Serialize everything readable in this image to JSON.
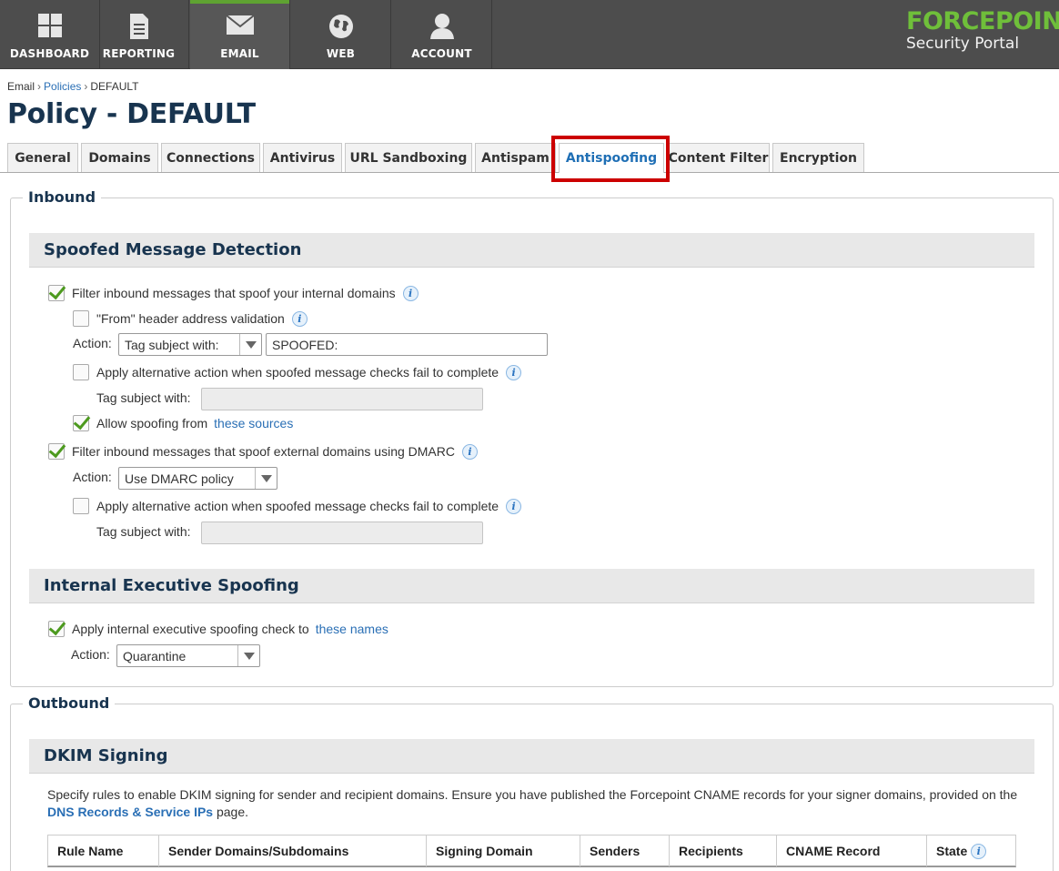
{
  "nav": {
    "items": [
      {
        "label": "DASHBOARD",
        "icon": "dashboard-grid-icon"
      },
      {
        "label": "REPORTING",
        "icon": "document-icon"
      },
      {
        "label": "EMAIL",
        "icon": "envelope-icon"
      },
      {
        "label": "WEB",
        "icon": "globe-icon"
      },
      {
        "label": "ACCOUNT",
        "icon": "user-icon"
      }
    ],
    "active": "EMAIL",
    "brand_name": "FORCEPOINT",
    "brand_sub": "Security Portal"
  },
  "breadcrumb": {
    "root": "Email",
    "policies": "Policies",
    "current": "DEFAULT"
  },
  "page_title": "Policy - DEFAULT",
  "tabs": [
    "General",
    "Domains",
    "Connections",
    "Antivirus",
    "URL Sandboxing",
    "Antispam",
    "Antispoofing",
    "Content Filter",
    "Encryption"
  ],
  "active_tab": "Antispoofing",
  "inbound": {
    "legend": "Inbound",
    "spoofed": {
      "heading": "Spoofed Message Detection",
      "filter_internal": "Filter inbound messages that spoof your internal domains",
      "from_header": "\"From\" header address validation",
      "action_label": "Action:",
      "action_value": "Tag subject with:",
      "tag_value": "SPOOFED:",
      "alt_action": "Apply alternative action when spoofed message checks fail to complete",
      "tag_label": "Tag subject with:",
      "allow_spoofing": "Allow spoofing from",
      "allow_link": "these sources",
      "filter_external": "Filter inbound messages that spoof external domains using DMARC",
      "dmarc_action": "Use DMARC policy",
      "alt_action2": "Apply alternative action when spoofed message checks fail to complete",
      "tag_label2": "Tag subject with:"
    },
    "executive": {
      "heading": "Internal Executive Spoofing",
      "apply_check": "Apply internal executive spoofing check to",
      "names_link": "these names",
      "action_label": "Action:",
      "action_value": "Quarantine"
    }
  },
  "outbound": {
    "legend": "Outbound",
    "dkim": {
      "heading": "DKIM Signing",
      "desc_1": "Specify rules to enable DKIM signing for sender and recipient domains. Ensure you have published the Forcepoint CNAME records for your signer domains, provided on the",
      "desc_link": "DNS Records & Service IPs",
      "desc_2": "page.",
      "columns": [
        "Rule Name",
        "Sender Domains/Subdomains",
        "Signing Domain",
        "Senders",
        "Recipients",
        "CNAME Record",
        "State"
      ]
    }
  }
}
